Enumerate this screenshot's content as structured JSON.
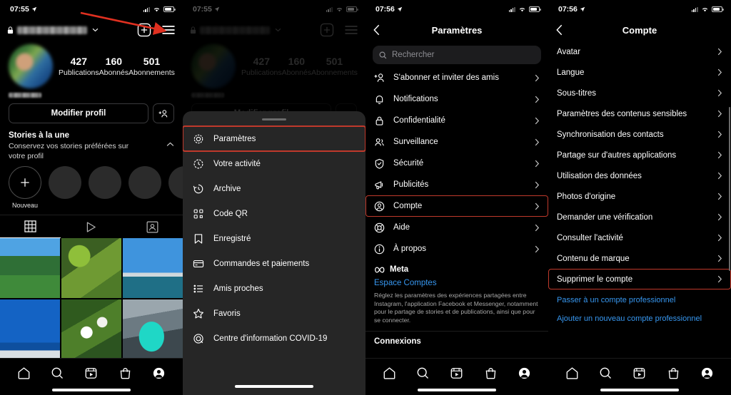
{
  "meta": {
    "accent_red": "#c0392b",
    "link_blue": "#3797f0",
    "background": "#000000",
    "sheet_background": "#262626"
  },
  "panel1": {
    "status": {
      "time": "07:55",
      "location_icon": "location-arrow-icon",
      "wifi_icon": "wifi-icon",
      "signal_icon": "cellular-signal-icon",
      "battery_icon": "battery-icon"
    },
    "header": {
      "lock_icon": "lock-icon",
      "username": "",
      "chevron_icon": "chevron-down-icon",
      "add_icon": "plus-square-icon",
      "menu_icon": "hamburger-menu-icon"
    },
    "stats": [
      {
        "num": "427",
        "label": "Publications"
      },
      {
        "num": "160",
        "label": "Abonnés"
      },
      {
        "num": "501",
        "label": "Abonnements"
      }
    ],
    "actions": {
      "edit_profile": "Modifier profil",
      "add_person_icon": "add-person-icon"
    },
    "highlights": {
      "title": "Stories à la une",
      "subtitle": "Conservez vos stories préférées sur votre profil",
      "collapse_icon": "chevron-up-icon",
      "new_label": "Nouveau",
      "new_icon": "plus-icon"
    },
    "tabs": [
      {
        "name": "grid",
        "icon": "grid-icon",
        "active": true
      },
      {
        "name": "reels",
        "icon": "play-icon",
        "active": false
      },
      {
        "name": "tagged",
        "icon": "tagged-person-icon",
        "active": false
      }
    ],
    "grid_photos": [
      "garden-path",
      "tree-branches",
      "seaside-bay",
      "blue-sky-roof",
      "white-daisies",
      "teal-sports-car"
    ],
    "bottom_nav": [
      "home-icon",
      "search-icon",
      "reels-icon",
      "shop-icon",
      "profile-icon"
    ]
  },
  "panel2": {
    "status": {
      "time": "07:55"
    },
    "sheet_items": [
      {
        "label": "Paramètres",
        "icon": "gear-icon",
        "highlighted": true
      },
      {
        "label": "Votre activité",
        "icon": "activity-clock-icon",
        "highlighted": false
      },
      {
        "label": "Archive",
        "icon": "archive-clock-icon",
        "highlighted": false
      },
      {
        "label": "Code QR",
        "icon": "qr-code-icon",
        "highlighted": false
      },
      {
        "label": "Enregistré",
        "icon": "bookmark-icon",
        "highlighted": false
      },
      {
        "label": "Commandes et paiements",
        "icon": "credit-card-icon",
        "highlighted": false
      },
      {
        "label": "Amis proches",
        "icon": "list-icon",
        "highlighted": false
      },
      {
        "label": "Favoris",
        "icon": "star-icon",
        "highlighted": false
      },
      {
        "label": "Centre d'information COVID-19",
        "icon": "covid-info-icon",
        "highlighted": false
      }
    ]
  },
  "panel3": {
    "status": {
      "time": "07:56"
    },
    "navbar": {
      "title": "Paramètres",
      "back_icon": "chevron-left-icon"
    },
    "search": {
      "placeholder": "Rechercher",
      "icon": "search-icon"
    },
    "items": [
      {
        "label": "S'abonner et inviter des amis",
        "icon": "add-person-icon",
        "highlighted": false
      },
      {
        "label": "Notifications",
        "icon": "bell-icon",
        "highlighted": false
      },
      {
        "label": "Confidentialité",
        "icon": "lock-icon",
        "highlighted": false
      },
      {
        "label": "Surveillance",
        "icon": "people-icon",
        "highlighted": false
      },
      {
        "label": "Sécurité",
        "icon": "shield-check-icon",
        "highlighted": false
      },
      {
        "label": "Publicités",
        "icon": "megaphone-icon",
        "highlighted": false
      },
      {
        "label": "Compte",
        "icon": "person-circle-icon",
        "highlighted": true
      },
      {
        "label": "Aide",
        "icon": "lifebuoy-icon",
        "highlighted": false
      },
      {
        "label": "À propos",
        "icon": "info-circle-icon",
        "highlighted": false
      }
    ],
    "meta": {
      "brand": "Meta",
      "brand_icon": "meta-infinity-icon",
      "link": "Espace Comptes",
      "description": "Réglez les paramètres des expériences partagées entre Instagram, l'application Facebook et Messenger, notamment pour le partage de stories et de publications, ainsi que pour se connecter."
    },
    "connections_heading": "Connexions"
  },
  "panel4": {
    "status": {
      "time": "07:56"
    },
    "navbar": {
      "title": "Compte",
      "back_icon": "chevron-left-icon"
    },
    "items": [
      {
        "label": "Avatar",
        "highlighted": false
      },
      {
        "label": "Langue",
        "highlighted": false
      },
      {
        "label": "Sous-titres",
        "highlighted": false
      },
      {
        "label": "Paramètres des contenus sensibles",
        "highlighted": false
      },
      {
        "label": "Synchronisation des contacts",
        "highlighted": false
      },
      {
        "label": "Partage sur d'autres applications",
        "highlighted": false
      },
      {
        "label": "Utilisation des données",
        "highlighted": false
      },
      {
        "label": "Photos d'origine",
        "highlighted": false
      },
      {
        "label": "Demander une vérification",
        "highlighted": false
      },
      {
        "label": "Consulter l'activité",
        "highlighted": false
      },
      {
        "label": "Contenu de marque",
        "highlighted": false
      },
      {
        "label": "Supprimer le compte",
        "highlighted": true
      }
    ],
    "links": [
      {
        "label": "Passer à un compte professionnel"
      },
      {
        "label": "Ajouter un nouveau compte professionnel"
      }
    ]
  }
}
